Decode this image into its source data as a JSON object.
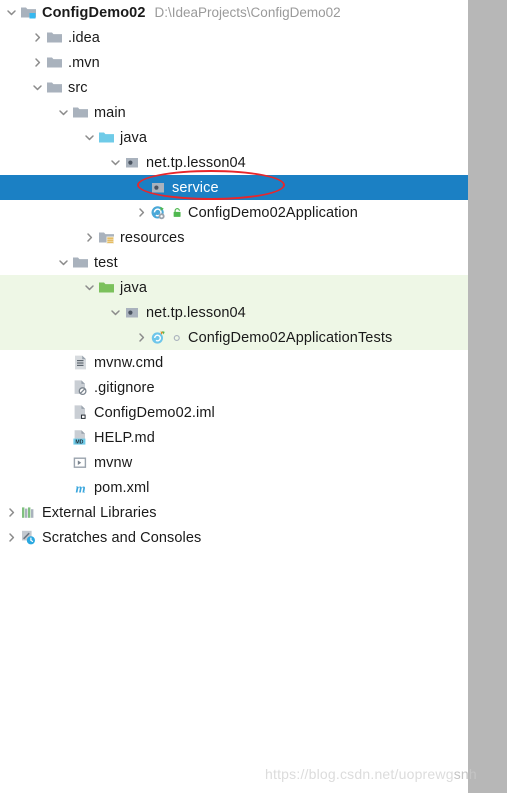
{
  "project": {
    "name": "ConfigDemo02",
    "path": "D:\\IdeaProjects\\ConfigDemo02"
  },
  "colors": {
    "selection_blue": "#1b80c4",
    "test_source_green": "#eef7e6",
    "annotation_red": "#e8262b",
    "path_gray": "#9a9a9a",
    "right_panel_gray": "#b7b7b7"
  },
  "watermark": {
    "text": "https://blog.csdn.net/uoprewg",
    "tail": "snh"
  },
  "tree": [
    {
      "label": "ConfigDemo02",
      "path": "D:\\IdeaProjects\\ConfigDemo02",
      "icon": "project-module-icon",
      "arrow": "chevron-down",
      "depth": 0,
      "bold": true,
      "state": "normal"
    },
    {
      "label": ".idea",
      "icon": "folder-icon",
      "arrow": "chevron-right",
      "depth": 1,
      "bold": false,
      "state": "normal"
    },
    {
      "label": ".mvn",
      "icon": "folder-icon",
      "arrow": "chevron-right",
      "depth": 1,
      "bold": false,
      "state": "normal"
    },
    {
      "label": "src",
      "icon": "folder-icon",
      "arrow": "chevron-down",
      "depth": 1,
      "bold": false,
      "state": "normal"
    },
    {
      "label": "main",
      "icon": "folder-icon",
      "arrow": "chevron-down",
      "depth": 2,
      "bold": false,
      "state": "normal"
    },
    {
      "label": "java",
      "icon": "source-root-folder-icon",
      "arrow": "chevron-down",
      "depth": 3,
      "bold": false,
      "state": "normal"
    },
    {
      "label": "net.tp.lesson04",
      "icon": "package-icon",
      "arrow": "chevron-down",
      "depth": 4,
      "bold": false,
      "state": "normal"
    },
    {
      "label": "service",
      "icon": "package-icon",
      "arrow": "none",
      "depth": 5,
      "bold": false,
      "state": "selected"
    },
    {
      "label": "ConfigDemo02Application",
      "icon": "spring-boot-class-icon",
      "badge": "green-lock-icon",
      "arrow": "chevron-right",
      "depth": 5,
      "bold": false,
      "state": "normal"
    },
    {
      "label": "resources",
      "icon": "resources-folder-icon",
      "arrow": "chevron-right",
      "depth": 3,
      "bold": false,
      "state": "normal"
    },
    {
      "label": "test",
      "icon": "folder-icon",
      "arrow": "chevron-down",
      "depth": 2,
      "bold": false,
      "state": "normal"
    },
    {
      "label": "java",
      "icon": "test-source-root-folder-icon",
      "arrow": "chevron-down",
      "depth": 3,
      "bold": false,
      "state": "green"
    },
    {
      "label": "net.tp.lesson04",
      "icon": "package-icon",
      "arrow": "chevron-down",
      "depth": 4,
      "bold": false,
      "state": "green"
    },
    {
      "label": "ConfigDemo02ApplicationTests",
      "icon": "test-class-icon",
      "badge": "circle-dot-icon",
      "arrow": "chevron-right",
      "depth": 5,
      "bold": false,
      "state": "green"
    },
    {
      "label": "mvnw.cmd",
      "icon": "cmd-file-icon",
      "arrow": "none",
      "depth": 2,
      "bold": false,
      "state": "normal"
    },
    {
      "label": ".gitignore",
      "icon": "gitignore-file-icon",
      "arrow": "none",
      "depth": 2,
      "bold": false,
      "state": "normal"
    },
    {
      "label": "ConfigDemo02.iml",
      "icon": "iml-file-icon",
      "arrow": "none",
      "depth": 2,
      "bold": false,
      "state": "normal"
    },
    {
      "label": "HELP.md",
      "icon": "markdown-file-icon",
      "arrow": "none",
      "depth": 2,
      "bold": false,
      "state": "normal"
    },
    {
      "label": "mvnw",
      "icon": "script-file-icon",
      "arrow": "none",
      "depth": 2,
      "bold": false,
      "state": "normal"
    },
    {
      "label": "pom.xml",
      "icon": "maven-pom-icon",
      "arrow": "none",
      "depth": 2,
      "bold": false,
      "state": "normal"
    },
    {
      "label": "External Libraries",
      "icon": "external-libraries-icon",
      "arrow": "chevron-right",
      "depth": 0,
      "bold": false,
      "state": "normal"
    },
    {
      "label": "Scratches and Consoles",
      "icon": "scratches-icon",
      "arrow": "chevron-right",
      "depth": 0,
      "bold": false,
      "state": "normal"
    }
  ]
}
